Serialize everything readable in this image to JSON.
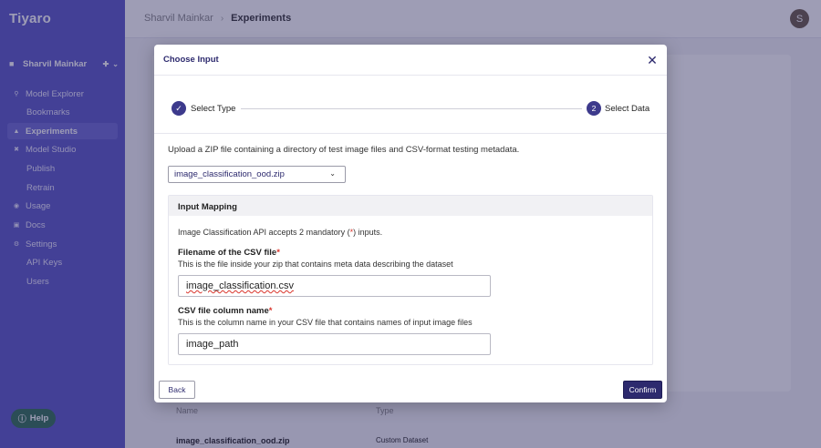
{
  "app": {
    "name": "Tiyaro"
  },
  "user": {
    "name": "Sharvil Mainkar",
    "avatar_initial": "S"
  },
  "sidebar": {
    "items": [
      {
        "label": "Model Explorer",
        "icon": "search-icon",
        "sub": false,
        "active": false
      },
      {
        "label": "Bookmarks",
        "icon": "",
        "sub": true,
        "active": false
      },
      {
        "label": "Experiments",
        "icon": "flask-icon",
        "sub": false,
        "active": true
      },
      {
        "label": "Model Studio",
        "icon": "studio-icon",
        "sub": false,
        "active": false
      },
      {
        "label": "Publish",
        "icon": "",
        "sub": true,
        "active": false
      },
      {
        "label": "Retrain",
        "icon": "",
        "sub": true,
        "active": false
      },
      {
        "label": "Usage",
        "icon": "gauge-icon",
        "sub": false,
        "active": false
      },
      {
        "label": "Docs",
        "icon": "docs-icon",
        "sub": false,
        "active": false
      },
      {
        "label": "Settings",
        "icon": "gear-icon",
        "sub": false,
        "active": false
      },
      {
        "label": "API Keys",
        "icon": "",
        "sub": true,
        "active": false
      },
      {
        "label": "Users",
        "icon": "",
        "sub": true,
        "active": false
      }
    ],
    "help_label": "Help"
  },
  "breadcrumb": {
    "parent": "Sharvil Mainkar",
    "current": "Experiments"
  },
  "background_table": {
    "headers": [
      "Name",
      "Type"
    ],
    "row": [
      "image_classification_ood.zip",
      "Custom Dataset"
    ]
  },
  "modal": {
    "title": "Choose Input",
    "steps": [
      {
        "number": "1",
        "label": "Select Type",
        "completed": true
      },
      {
        "number": "2",
        "label": "Select Data",
        "completed": false
      }
    ],
    "upload_text": "Upload a ZIP file containing a directory of test image files and CSV-format testing metadata.",
    "selected_file": "image_classification_ood.zip",
    "mapping": {
      "title": "Input Mapping",
      "accept_prefix": "Image Classification API accepts 2 mandatory (",
      "accept_star": "*",
      "accept_suffix": ") inputs.",
      "fields": [
        {
          "label": "Filename of the CSV file",
          "required_mark": "*",
          "description": "This is the file inside your zip that contains meta data describing the dataset",
          "value": "image_classification.csv"
        },
        {
          "label": "CSV file column name",
          "required_mark": "*",
          "description": "This is the column name in your CSV file that contains names of input image files",
          "value": "image_path"
        }
      ]
    },
    "back_label": "Back",
    "confirm_label": "Confirm"
  },
  "colors": {
    "sidebar": "#5a57c6",
    "accent": "#2d2a6e",
    "required": "#d9342b",
    "help": "#2f6e52"
  }
}
